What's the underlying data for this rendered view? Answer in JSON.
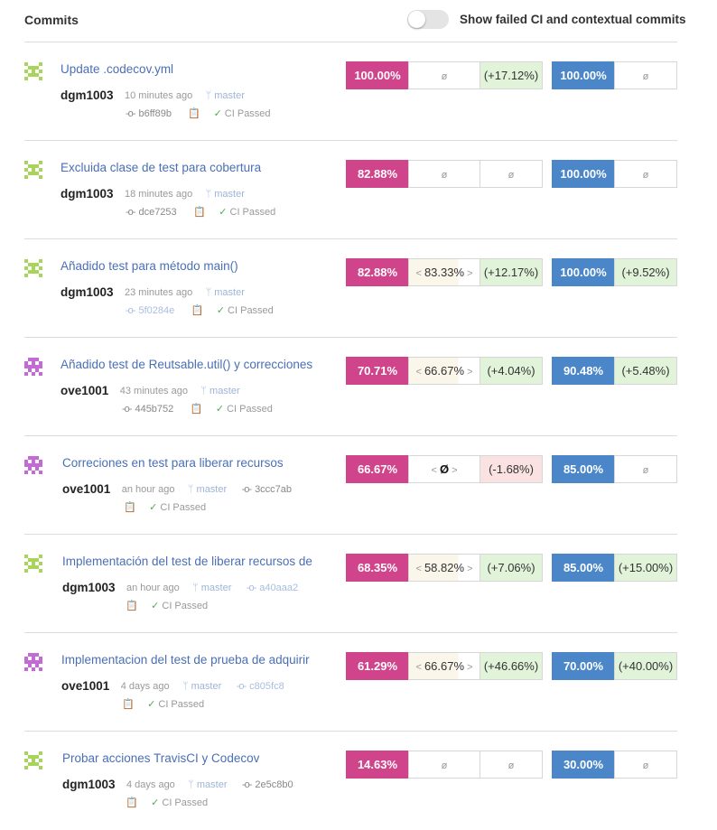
{
  "header": {
    "title": "Commits",
    "toggle_label": "Show failed CI and contextual commits"
  },
  "colors": {
    "project_coverage": "#d0448b",
    "patch_coverage": "#4a86c8",
    "positive_change": "#e1f4d9",
    "negative_change": "#fbe2e2",
    "link": "#4a6fb5"
  },
  "commits": [
    {
      "message": "Update .codecov.yml",
      "author": "dgm1003",
      "time": "10 minutes ago",
      "branch": "master",
      "sha": "b6ff89b",
      "ci_status": "CI Passed",
      "avatar_icon": "identicon-green",
      "coverage": "100.00%",
      "patch": "ø",
      "change": "(+17.12%)",
      "diff_coverage": "100.00%",
      "diff_change": "ø"
    },
    {
      "message": "Excluida clase de test para cobertura",
      "author": "dgm1003",
      "time": "18 minutes ago",
      "branch": "master",
      "sha": "dce7253",
      "ci_status": "CI Passed",
      "avatar_icon": "identicon-green",
      "coverage": "82.88%",
      "patch": "ø",
      "change": "ø",
      "diff_coverage": "100.00%",
      "diff_change": "ø"
    },
    {
      "message": "Añadido test para método main()",
      "author": "dgm1003",
      "time": "23 minutes ago",
      "branch": "master",
      "sha": "5f0284e",
      "ci_status": "CI Passed",
      "avatar_icon": "identicon-green",
      "coverage": "82.88%",
      "patch": "83.33%",
      "change": "(+12.17%)",
      "diff_coverage": "100.00%",
      "diff_change": "(+9.52%)"
    },
    {
      "message": "Añadido test de Reutsable.util() y correcciones",
      "author": "ove1001",
      "time": "43 minutes ago",
      "branch": "master",
      "sha": "445b752",
      "ci_status": "CI Passed",
      "avatar_icon": "identicon-purple",
      "coverage": "70.71%",
      "patch": "66.67%",
      "change": "(+4.04%)",
      "diff_coverage": "90.48%",
      "diff_change": "(+5.48%)"
    },
    {
      "message": "Correciones en test para liberar recursos",
      "author": "ove1001",
      "time": "an hour ago",
      "branch": "master",
      "sha": "3ccc7ab",
      "ci_status": "CI Passed",
      "avatar_icon": "identicon-purple",
      "coverage": "66.67%",
      "patch": "Ø",
      "change": "(-1.68%)",
      "diff_coverage": "85.00%",
      "diff_change": "ø"
    },
    {
      "message": "Implementación del test de liberar recursos de",
      "author": "dgm1003",
      "time": "an hour ago",
      "branch": "master",
      "sha": "a40aaa2",
      "ci_status": "CI Passed",
      "avatar_icon": "identicon-green",
      "coverage": "68.35%",
      "patch": "58.82%",
      "change": "(+7.06%)",
      "diff_coverage": "85.00%",
      "diff_change": "(+15.00%)"
    },
    {
      "message": "Implementacion del test de prueba de adquirir",
      "author": "ove1001",
      "time": "4 days ago",
      "branch": "master",
      "sha": "c805fc8",
      "ci_status": "CI Passed",
      "avatar_icon": "identicon-purple",
      "coverage": "61.29%",
      "patch": "66.67%",
      "change": "(+46.66%)",
      "diff_coverage": "70.00%",
      "diff_change": "(+40.00%)"
    },
    {
      "message": "Probar acciones TravisCI y Codecov",
      "author": "dgm1003",
      "time": "4 days ago",
      "branch": "master",
      "sha": "2e5c8b0",
      "ci_status": "CI Passed",
      "avatar_icon": "identicon-green",
      "coverage": "14.63%",
      "patch": "ø",
      "change": "ø",
      "diff_coverage": "30.00%",
      "diff_change": "ø"
    }
  ]
}
